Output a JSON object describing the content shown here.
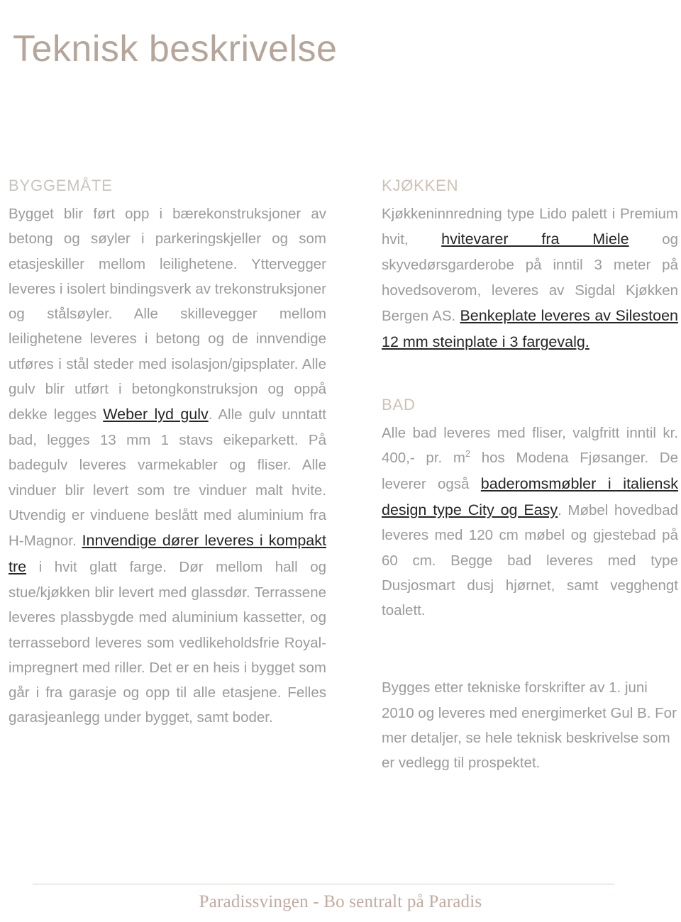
{
  "document": {
    "title": "Teknisk beskrivelse"
  },
  "colors": {
    "title": "#b6a699",
    "heading": "#cdc2b5",
    "body": "#9b9b9b",
    "highlight": "#262626",
    "footer_text": "#c4aa9e",
    "footer_rule": "#d9c9c4"
  },
  "left_column": {
    "sections": [
      {
        "heading": "BYGGEMÅTE",
        "paragraphs": [
          {
            "runs": [
              {
                "text": "Bygget blir ført opp i bærekonstruksjoner av betong og søyler i parkeringskjeller og som etasjeskiller mellom leilighetene. Yttervegger leveres i isolert bindingsverk av trekonstruksjoner og stålsøyler. Alle skillevegger mellom leilighetene leveres i betong og de innvendige utføres i stål steder med isolasjon/gipsplater. Alle gulv blir utført i betongkonstruksjon og oppå dekke legges ",
                "style": "normal"
              },
              {
                "text": "Weber lyd gulv",
                "style": "highlight"
              },
              {
                "text": ". Alle gulv unntatt bad, legges 13 mm 1 stavs eikeparkett. På badegulv leveres varmekabler og fliser. Alle vinduer blir levert som tre vinduer malt hvite. Utvendig er vinduene beslått med aluminium fra H-Magnor. ",
                "style": "normal"
              },
              {
                "text": "Innvendige dører leveres i kompakt tre",
                "style": "highlight"
              },
              {
                "text": " i hvit glatt farge. Dør mellom hall og stue/kjøkken blir levert med glassdør. Terrassene leveres plassbygde med aluminium kassetter, og terrassebord leveres som vedlikeholdsfrie Royal-impregnert med riller. Det er en heis i bygget som går i fra garasje og opp til alle etasjene. Felles garasjeanlegg under bygget, samt boder.",
                "style": "normal"
              }
            ]
          }
        ]
      }
    ]
  },
  "right_column": {
    "sections": [
      {
        "heading": "KJØKKEN",
        "paragraphs": [
          {
            "runs": [
              {
                "text": "Kjøkkeninnredning type Lido palett i Premium hvit, ",
                "style": "normal"
              },
              {
                "text": "hvitevarer fra Miele",
                "style": "highlight"
              },
              {
                "text": " og skyvedørsgarderobe på inntil 3 meter på hovedsoverom, leveres av Sigdal Kjøkken Bergen AS. ",
                "style": "normal"
              },
              {
                "text": "Benkeplate leveres av Silestoen 12 mm steinplate i 3 fargevalg.",
                "style": "highlight"
              }
            ]
          }
        ]
      },
      {
        "heading": "BAD",
        "paragraphs": [
          {
            "runs": [
              {
                "text": "Alle bad leveres med fliser, valgfritt inntil kr. 400,- pr. m",
                "style": "normal"
              },
              {
                "text": "2",
                "style": "superscript"
              },
              {
                "text": " hos Modena Fjøsanger. De leverer også ",
                "style": "normal"
              },
              {
                "text": "baderomsmøbler i italiensk design type City og Easy",
                "style": "highlight"
              },
              {
                "text": ". Møbel hovedbad leveres med 120 cm møbel og gjestebad på 60 cm. Begge bad leveres med type Dusjosmart dusj hjørnet, samt vegghengt toalett.",
                "style": "normal"
              }
            ]
          }
        ]
      }
    ],
    "closing_note": {
      "text": "Bygges etter tekniske forskrifter av 1. juni 2010 og leveres med energimerket Gul B. For mer detaljer, se hele teknisk beskrivelse som er vedlegg til prospektet."
    }
  },
  "footer": {
    "text": "Paradissvingen - Bo sentralt på Paradis"
  }
}
